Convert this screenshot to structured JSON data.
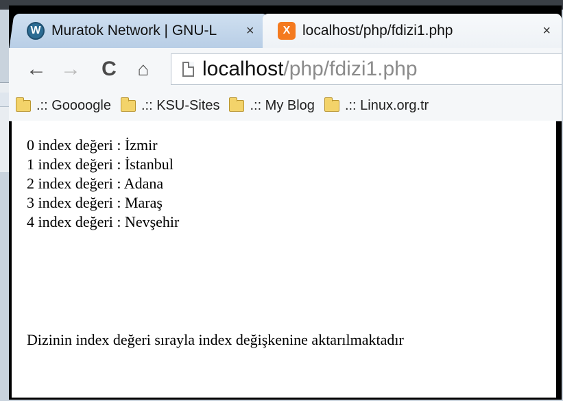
{
  "tabs": [
    {
      "title": "Muratok Network | GNU-L",
      "icon": "wordpress-icon",
      "close": "×"
    },
    {
      "title": "localhost/php/fdizi1.php",
      "icon": "xampp-icon",
      "close": "×"
    }
  ],
  "toolbar": {
    "back": "←",
    "forward": "→",
    "reload": "C",
    "home": "⌂",
    "url_host": "localhost",
    "url_path": "/php/fdizi1.php"
  },
  "bookmarks": [
    ".:: Goooogle",
    ".:: KSU-Sites",
    ".:: My Blog",
    ".:: Linux.org.tr"
  ],
  "content": {
    "lines": [
      "0 index değeri : İzmir",
      "1 index değeri : İstanbul",
      "2 index değeri : Adana",
      "3 index değeri : Maraş",
      "4 index değeri : Nevşehir"
    ],
    "footer": "Dizinin index değeri sırayla index değişkenine aktarılmaktadır"
  }
}
